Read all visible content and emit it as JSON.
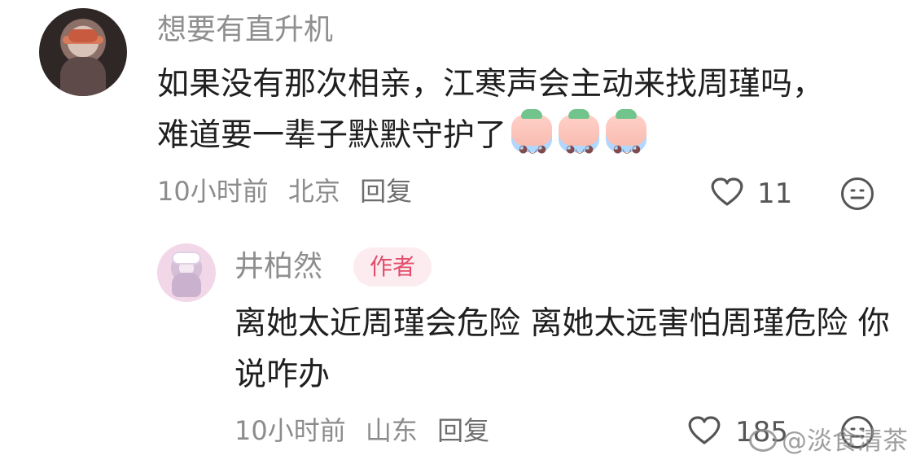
{
  "comments": [
    {
      "user": "想要有直升机",
      "text": "如果没有那次相亲，江寒声会主动来找周瑾吗，难道要一辈子默默守护了",
      "time": "10小时前",
      "location": "北京",
      "reply_label": "回复",
      "likes": "11",
      "emoji_count": 3,
      "icons": {
        "like": "heart-outline-icon",
        "react": "neutral-face-icon"
      }
    },
    {
      "user": "井柏然",
      "badge": "作者",
      "text": "离她太近周瑾会危险 离她太远害怕周瑾危险 你说咋办",
      "time": "10小时前",
      "location": "山东",
      "reply_label": "回复",
      "likes": "185",
      "icons": {
        "like": "heart-outline-icon",
        "react": "neutral-face-icon"
      }
    }
  ],
  "watermark": {
    "text": "@淡食清茶",
    "icon": "weibo-logo-icon"
  },
  "colors": {
    "badge_bg": "#fdecef",
    "badge_text": "#e34d6b"
  }
}
